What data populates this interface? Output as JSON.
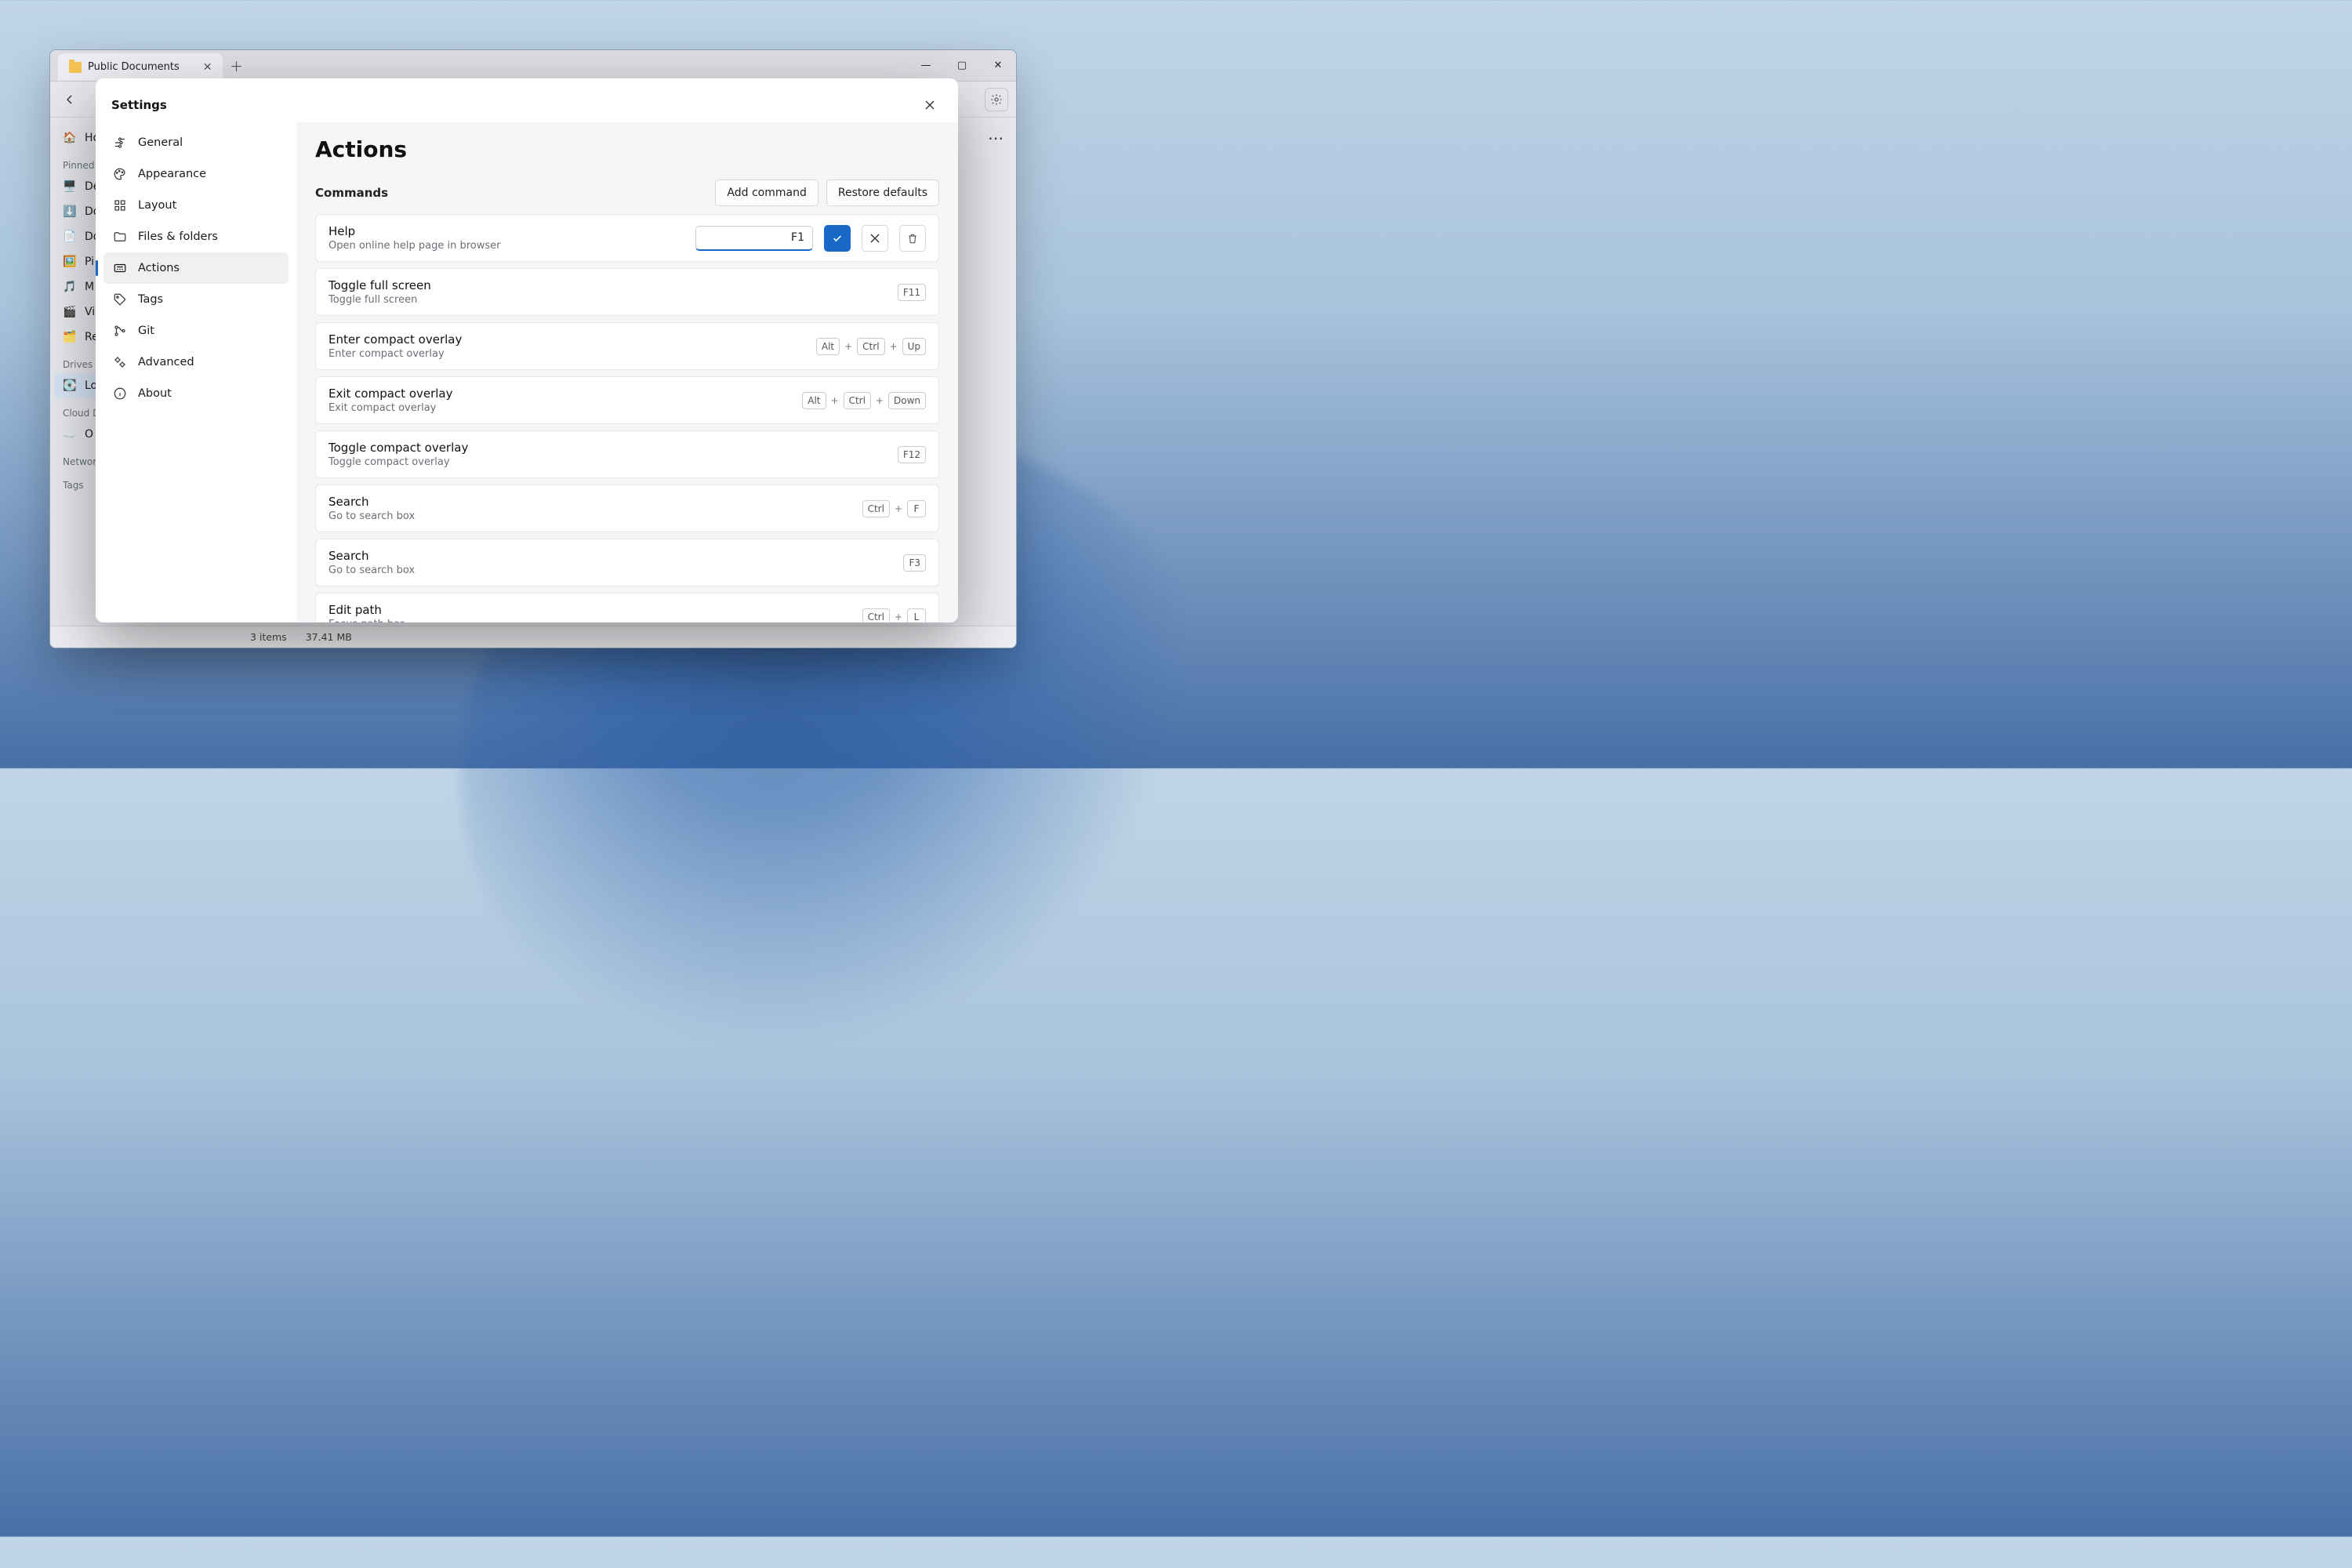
{
  "window": {
    "tab_title": "Public Documents",
    "controls": {
      "min": "—",
      "max": "▢",
      "close": "✕"
    }
  },
  "back_sidebar": {
    "home": "Ho",
    "pinned_label": "Pinned",
    "items": [
      "De",
      "Do",
      "Do",
      "Pi",
      "M",
      "Vi",
      "Re"
    ],
    "drives_label": "Drives",
    "drive_item": "Lo",
    "cloud_label": "Cloud D",
    "cloud_item": "O",
    "network_label": "Network",
    "tags_label": "Tags"
  },
  "statusbar": {
    "items": "3 items",
    "size": "37.41 MB"
  },
  "dialog": {
    "title": "Settings",
    "nav": [
      {
        "id": "general",
        "label": "General"
      },
      {
        "id": "appearance",
        "label": "Appearance"
      },
      {
        "id": "layout",
        "label": "Layout"
      },
      {
        "id": "files",
        "label": "Files & folders"
      },
      {
        "id": "actions",
        "label": "Actions"
      },
      {
        "id": "tags",
        "label": "Tags"
      },
      {
        "id": "git",
        "label": "Git"
      },
      {
        "id": "advanced",
        "label": "Advanced"
      },
      {
        "id": "about",
        "label": "About"
      }
    ],
    "active_nav": "actions",
    "page_title": "Actions",
    "section_label": "Commands",
    "add_btn": "Add command",
    "restore_btn": "Restore defaults",
    "editing": {
      "index": 0,
      "value": "F1"
    },
    "commands": [
      {
        "title": "Help",
        "desc": "Open online help page in browser",
        "keys": [
          "F1"
        ]
      },
      {
        "title": "Toggle full screen",
        "desc": "Toggle full screen",
        "keys": [
          "F11"
        ]
      },
      {
        "title": "Enter compact overlay",
        "desc": "Enter compact overlay",
        "keys": [
          "Alt",
          "Ctrl",
          "Up"
        ]
      },
      {
        "title": "Exit compact overlay",
        "desc": "Exit compact overlay",
        "keys": [
          "Alt",
          "Ctrl",
          "Down"
        ]
      },
      {
        "title": "Toggle compact overlay",
        "desc": "Toggle compact overlay",
        "keys": [
          "F12"
        ]
      },
      {
        "title": "Search",
        "desc": "Go to search box",
        "keys": [
          "Ctrl",
          "F"
        ]
      },
      {
        "title": "Search",
        "desc": "Go to search box",
        "keys": [
          "F3"
        ]
      },
      {
        "title": "Edit path",
        "desc": "Focus path bar",
        "keys": [
          "Ctrl",
          "L"
        ]
      }
    ]
  }
}
